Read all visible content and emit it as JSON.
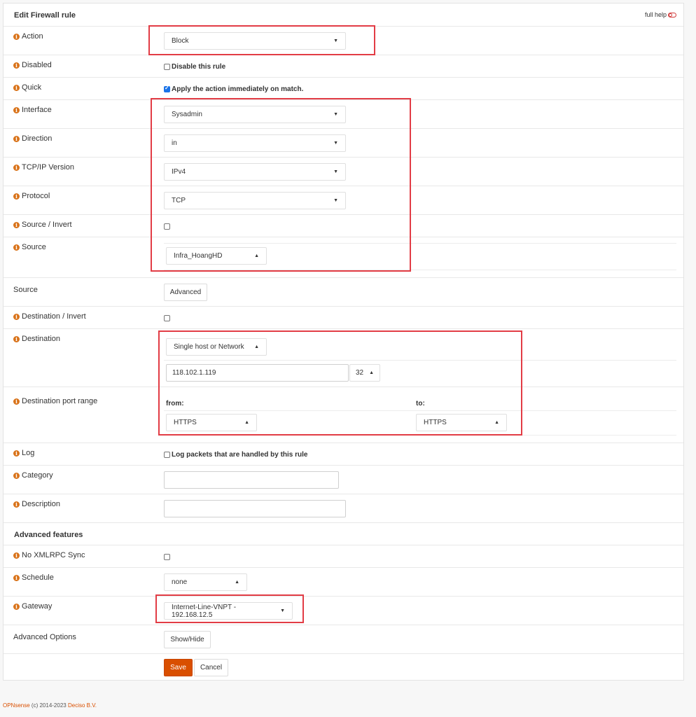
{
  "header": {
    "title": "Edit Firewall rule",
    "full_help": "full help"
  },
  "fields": {
    "action": {
      "label": "Action",
      "value": "Block"
    },
    "disabled": {
      "label": "Disabled",
      "checkbox_label": "Disable this rule",
      "checked": false
    },
    "quick": {
      "label": "Quick",
      "checkbox_label": "Apply the action immediately on match.",
      "checked": true
    },
    "interface": {
      "label": "Interface",
      "value": "Sysadmin"
    },
    "direction": {
      "label": "Direction",
      "value": "in"
    },
    "ipversion": {
      "label": "TCP/IP Version",
      "value": "IPv4"
    },
    "protocol": {
      "label": "Protocol",
      "value": "TCP"
    },
    "source_invert": {
      "label": "Source / Invert",
      "checked": false
    },
    "source": {
      "label": "Source",
      "value": "Infra_HoangHD"
    },
    "source_adv": {
      "label": "Source",
      "button": "Advanced"
    },
    "dest_invert": {
      "label": "Destination / Invert",
      "checked": false
    },
    "destination": {
      "label": "Destination",
      "type_value": "Single host or Network",
      "address": "118.102.1.119",
      "mask": "32"
    },
    "dest_port": {
      "label": "Destination port range",
      "from_label": "from:",
      "to_label": "to:",
      "from_value": "HTTPS",
      "to_value": "HTTPS"
    },
    "log": {
      "label": "Log",
      "checkbox_label": "Log packets that are handled by this rule",
      "checked": false
    },
    "category": {
      "label": "Category",
      "value": ""
    },
    "description": {
      "label": "Description",
      "value": ""
    },
    "advanced_features": {
      "label": "Advanced features"
    },
    "no_xmlrpc": {
      "label": "No XMLRPC Sync",
      "checked": false
    },
    "schedule": {
      "label": "Schedule",
      "value": "none"
    },
    "gateway": {
      "label": "Gateway",
      "value": "Internet-Line-VNPT - 192.168.12.5"
    },
    "advanced_options": {
      "label": "Advanced Options",
      "button": "Show/Hide"
    }
  },
  "actions": {
    "save": "Save",
    "cancel": "Cancel"
  },
  "footer": {
    "brand": "OPNsense",
    "copyright": "(c) 2014-2023",
    "company": "Deciso B.V."
  },
  "colors": {
    "accent": "#d94f00",
    "highlight": "#e23c45",
    "checkbox": "#1a73e8"
  }
}
